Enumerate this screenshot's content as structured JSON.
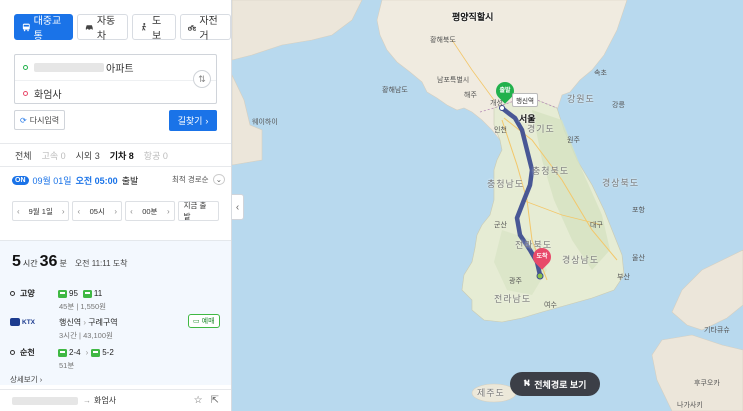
{
  "modes": [
    {
      "label": "대중교통",
      "icon": "bus-icon",
      "active": true
    },
    {
      "label": "자동차",
      "icon": "car-icon",
      "active": false
    },
    {
      "label": "도보",
      "icon": "walk-icon",
      "active": false
    },
    {
      "label": "자전거",
      "icon": "bicycle-icon",
      "active": false
    }
  ],
  "route": {
    "start_suffix": "아파트",
    "end": "화엄사"
  },
  "buttons": {
    "reset": "다시입력",
    "search": "길찾기"
  },
  "filter_tabs": [
    {
      "label": "전체",
      "state": "normal"
    },
    {
      "label": "고속 0",
      "state": "disabled"
    },
    {
      "label": "시외 3",
      "state": "normal"
    },
    {
      "label": "기차 8",
      "state": "active"
    },
    {
      "label": "항공 0",
      "state": "disabled"
    }
  ],
  "time": {
    "on_badge": "ON",
    "date": "09월 01일",
    "clock": "오전 05:00",
    "suffix": "출발",
    "sort": "최적 경로순"
  },
  "selectors": {
    "day": "9월 1일",
    "hour": "05시",
    "minute": "00분",
    "now": "지금 출발"
  },
  "result": {
    "hours": "5",
    "hours_unit": "시간",
    "minutes": "36",
    "minutes_unit": "분",
    "arrival": "오전 11:11 도착",
    "legs": {
      "leg1": {
        "name": "고양",
        "bus1": "95",
        "bus2": "11",
        "sub": "45분 | 1,550원"
      },
      "train": {
        "brand": "KTX",
        "route_from": "행신역",
        "route_to": "구례구역",
        "sub": "3시간 | 43,100원",
        "book": "예매"
      },
      "leg3": {
        "name": "순천",
        "bus1": "2-4",
        "bus2": "5-2",
        "sub": "51분"
      }
    },
    "details": "상세보기"
  },
  "bottom": {
    "destination": "화엄사"
  },
  "map": {
    "labels": {
      "pyongyang": "평양직할시",
      "seoul": "서울",
      "gangwon": "강원도",
      "gyeonggi": "경기도",
      "chungbuk": "충청북도",
      "chungnam": "충청남도",
      "gyeongbuk": "경상북도",
      "gyeongnam": "경상남도",
      "jeonbuk": "전라북도",
      "jeonnam": "전라남도",
      "jeju": "제주도",
      "gunsan": "군산",
      "gwangju": "광주",
      "yeosu": "여수",
      "busan": "부산",
      "daegu": "대구",
      "wonju": "원주",
      "pohang": "포항",
      "ulsan": "울산",
      "weihai": "웨이하이",
      "sokcho": "속초",
      "gangneung": "강릉",
      "hwanghae_n": "황해북도",
      "hwanghae_s": "황해남도",
      "nampo": "남포특별시",
      "haeju": "해주",
      "kaesong": "개성",
      "incheon": "인천",
      "fukuoka": "후쿠오카",
      "kitakyushu": "기타큐슈",
      "nagasaki": "나가사키"
    },
    "start_pin": "출발",
    "end_pin": "도착",
    "station_tag": "행신역",
    "full_route": "전체경로 보기",
    "route_color": "#3b4a8f"
  }
}
